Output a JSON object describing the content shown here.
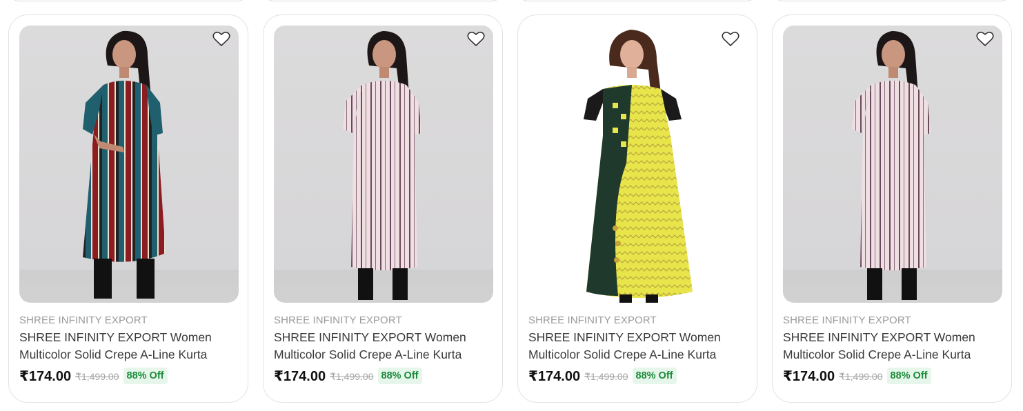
{
  "products": [
    {
      "brand": "SHREE INFINITY EXPORT",
      "title": "SHREE INFINITY EXPORT Women Multicolor Solid Crepe A-Line Kurta",
      "price": "₹174.00",
      "mrp": "₹1,499.00",
      "discount": "88% Off",
      "image": "multicolor-stripe-kurta",
      "colors": [
        "#1f5f6e",
        "#8b1c22",
        "#e7e2d0",
        "#1a1a1a"
      ]
    },
    {
      "brand": "SHREE INFINITY EXPORT",
      "title": "SHREE INFINITY EXPORT Women Multicolor Solid Crepe A-Line Kurta",
      "price": "₹174.00",
      "mrp": "₹1,499.00",
      "discount": "88% Off",
      "image": "pink-stripe-kurta",
      "colors": [
        "#efdfe2",
        "#6a4a5a"
      ]
    },
    {
      "brand": "SHREE INFINITY EXPORT",
      "title": "SHREE INFINITY EXPORT Women Multicolor Solid Crepe A-Line Kurta",
      "price": "₹174.00",
      "mrp": "₹1,499.00",
      "discount": "88% Off",
      "image": "green-yellow-kurta",
      "colors": [
        "#1f3a2c",
        "#e8e54a",
        "#c8a23a"
      ]
    },
    {
      "brand": "SHREE INFINITY EXPORT",
      "title": "SHREE INFINITY EXPORT Women Multicolor Solid Crepe A-Line Kurta",
      "price": "₹174.00",
      "mrp": "₹1,499.00",
      "discount": "88% Off",
      "image": "pink-stripe-kurta",
      "colors": [
        "#efdfe2",
        "#6a4a5a"
      ]
    }
  ],
  "icons": {
    "wishlist": "heart-outline-icon"
  }
}
